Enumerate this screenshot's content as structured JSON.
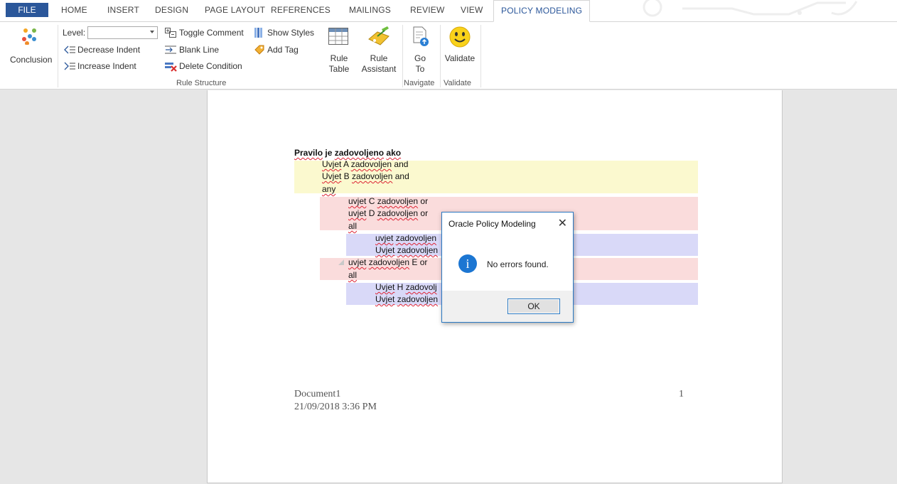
{
  "menu": {
    "file": "FILE",
    "tabs": [
      "HOME",
      "INSERT",
      "DESIGN",
      "PAGE LAYOUT",
      "REFERENCES",
      "MAILINGS",
      "REVIEW",
      "VIEW"
    ],
    "active_tab": "POLICY MODELING"
  },
  "ribbon": {
    "conclusion": "Conclusion",
    "level_label": "Level:",
    "level_value": "",
    "decrease_indent": "Decrease Indent",
    "increase_indent": "Increase Indent",
    "toggle_comment": "Toggle Comment",
    "blank_line": "Blank Line",
    "delete_condition": "Delete Condition",
    "show_styles": "Show Styles",
    "add_tag": "Add Tag",
    "rule_table_1": "Rule",
    "rule_table_2": "Table",
    "rule_assistant_1": "Rule",
    "rule_assistant_2": "Assistant",
    "goto_1": "Go",
    "goto_2": "To",
    "validate": "Validate",
    "groups": {
      "rule_structure": "Rule Structure",
      "navigate": "Navigate",
      "validate": "Validate"
    }
  },
  "document": {
    "heading": {
      "w1": "Pravilo",
      "w2": " je ",
      "w3": "zadovoljeno",
      "w4": " ",
      "w5": "ako"
    },
    "lines": [
      {
        "a": "Uvjet",
        "b": " A ",
        "c": "zadovoljen",
        "d": " and"
      },
      {
        "a": "Uvjet",
        "b": " B ",
        "c": "zadovoljen",
        "d": " and"
      },
      {
        "a": "any",
        "b": "",
        "c": "",
        "d": ""
      },
      {
        "a": "uvjet",
        "b": " C ",
        "c": "zadovoljen",
        "d": " or"
      },
      {
        "a": "uvjet",
        "b": " D ",
        "c": "zadovoljen",
        "d": " or"
      },
      {
        "a": "all",
        "b": "",
        "c": "",
        "d": ""
      },
      {
        "a": "uvjet",
        "b": " ",
        "c": "zadovoljen",
        "d": ""
      },
      {
        "a": "Uvjet",
        "b": " ",
        "c": "zadovoljen",
        "d": ""
      },
      {
        "a": "uvjet",
        "b": " ",
        "c": "zadovoljen",
        "d": " E or"
      },
      {
        "a": "all",
        "b": "",
        "c": "",
        "d": ""
      },
      {
        "a": "Uvjet",
        "b": " H ",
        "c": "zadovolj",
        "d": ""
      },
      {
        "a": "Uvjet",
        "b": " ",
        "c": "zadovoljen",
        "d": ""
      }
    ],
    "footer_name": "Document1",
    "footer_date": "21/09/2018 3:36 PM",
    "page_number": "1"
  },
  "dialog": {
    "title": "Oracle Policy Modeling",
    "message": "No errors found.",
    "ok": "OK",
    "close": "✕"
  },
  "colors": {
    "accent": "#2b579a",
    "yellow_band": "#fbf9cf",
    "pink_band": "#fadcdc",
    "blue_band": "#d9d9f8",
    "info_icon": "#1c76d2"
  }
}
